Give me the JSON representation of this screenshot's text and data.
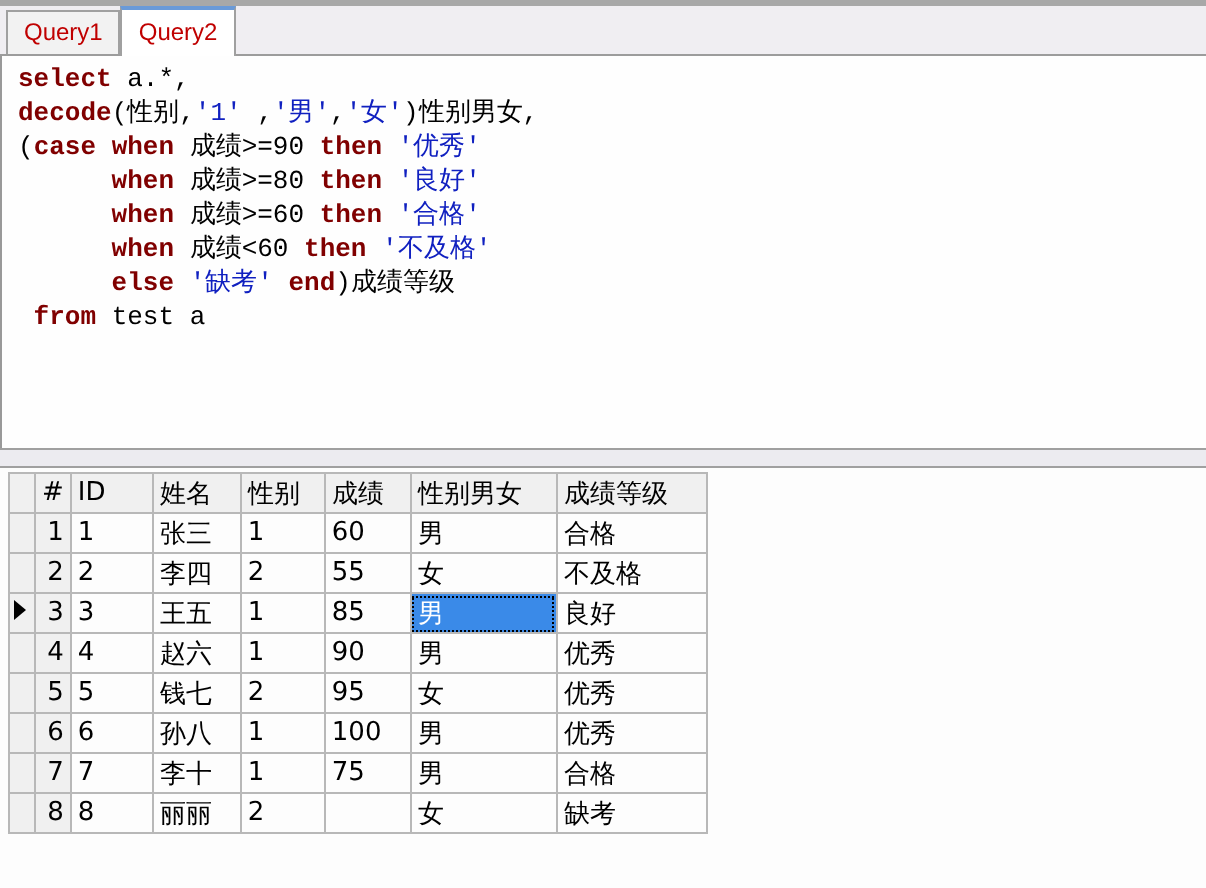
{
  "tabs": [
    {
      "label": "Query1",
      "selected": false
    },
    {
      "label": "Query2",
      "selected": true
    }
  ],
  "editor": {
    "lines": [
      {
        "tokens": [
          {
            "kind": "keyword",
            "text": "select"
          },
          {
            "kind": "plain",
            "text": " a.*,"
          }
        ]
      },
      {
        "tokens": [
          {
            "kind": "keyword",
            "text": "decode"
          },
          {
            "kind": "plain",
            "text": "(性别,"
          },
          {
            "kind": "string",
            "text": "'1'"
          },
          {
            "kind": "plain",
            "text": " ,"
          },
          {
            "kind": "string",
            "text": "'男'"
          },
          {
            "kind": "plain",
            "text": ","
          },
          {
            "kind": "string",
            "text": "'女'"
          },
          {
            "kind": "plain",
            "text": ")性别男女,"
          }
        ]
      },
      {
        "tokens": [
          {
            "kind": "plain",
            "text": "("
          },
          {
            "kind": "keyword",
            "text": "case when"
          },
          {
            "kind": "plain",
            "text": " 成绩>=90 "
          },
          {
            "kind": "keyword",
            "text": "then"
          },
          {
            "kind": "string",
            "text": " '优秀'"
          }
        ]
      },
      {
        "tokens": [
          {
            "kind": "keyword",
            "text": "      when"
          },
          {
            "kind": "plain",
            "text": " 成绩>=80 "
          },
          {
            "kind": "keyword",
            "text": "then"
          },
          {
            "kind": "string",
            "text": " '良好'"
          }
        ]
      },
      {
        "tokens": [
          {
            "kind": "keyword",
            "text": "      when"
          },
          {
            "kind": "plain",
            "text": " 成绩>=60 "
          },
          {
            "kind": "keyword",
            "text": "then"
          },
          {
            "kind": "string",
            "text": " '合格'"
          }
        ]
      },
      {
        "tokens": [
          {
            "kind": "keyword",
            "text": "      when"
          },
          {
            "kind": "plain",
            "text": " 成绩<60 "
          },
          {
            "kind": "keyword",
            "text": "then"
          },
          {
            "kind": "string",
            "text": " '不及格'"
          }
        ]
      },
      {
        "tokens": [
          {
            "kind": "keyword",
            "text": "      else"
          },
          {
            "kind": "string",
            "text": " '缺考' "
          },
          {
            "kind": "keyword",
            "text": "end"
          },
          {
            "kind": "plain",
            "text": ")成绩等级"
          }
        ]
      },
      {
        "tokens": [
          {
            "kind": "keyword",
            "text": " from"
          },
          {
            "kind": "plain",
            "text": " test a"
          }
        ]
      }
    ]
  },
  "grid": {
    "columns": [
      "#",
      "ID",
      "姓名",
      "性别",
      "成绩",
      "性别男女",
      "成绩等级"
    ],
    "rows": [
      {
        "current": false,
        "cells": [
          {
            "text": "1",
            "selected": false
          },
          {
            "text": "1",
            "selected": false
          },
          {
            "text": "张三",
            "selected": false
          },
          {
            "text": "1",
            "selected": false
          },
          {
            "text": "60",
            "selected": false
          },
          {
            "text": "男",
            "selected": false
          },
          {
            "text": "合格",
            "selected": false
          }
        ]
      },
      {
        "current": false,
        "cells": [
          {
            "text": "2",
            "selected": false
          },
          {
            "text": "2",
            "selected": false
          },
          {
            "text": "李四",
            "selected": false
          },
          {
            "text": "2",
            "selected": false
          },
          {
            "text": "55",
            "selected": false
          },
          {
            "text": "女",
            "selected": false
          },
          {
            "text": "不及格",
            "selected": false
          }
        ]
      },
      {
        "current": true,
        "cells": [
          {
            "text": "3",
            "selected": false
          },
          {
            "text": "3",
            "selected": false
          },
          {
            "text": "王五",
            "selected": false
          },
          {
            "text": "1",
            "selected": false
          },
          {
            "text": "85",
            "selected": false
          },
          {
            "text": "男",
            "selected": true
          },
          {
            "text": "良好",
            "selected": false
          }
        ]
      },
      {
        "current": false,
        "cells": [
          {
            "text": "4",
            "selected": false
          },
          {
            "text": "4",
            "selected": false
          },
          {
            "text": "赵六",
            "selected": false
          },
          {
            "text": "1",
            "selected": false
          },
          {
            "text": "90",
            "selected": false
          },
          {
            "text": "男",
            "selected": false
          },
          {
            "text": "优秀",
            "selected": false
          }
        ]
      },
      {
        "current": false,
        "cells": [
          {
            "text": "5",
            "selected": false
          },
          {
            "text": "5",
            "selected": false
          },
          {
            "text": "钱七",
            "selected": false
          },
          {
            "text": "2",
            "selected": false
          },
          {
            "text": "95",
            "selected": false
          },
          {
            "text": "女",
            "selected": false
          },
          {
            "text": "优秀",
            "selected": false
          }
        ]
      },
      {
        "current": false,
        "cells": [
          {
            "text": "6",
            "selected": false
          },
          {
            "text": "6",
            "selected": false
          },
          {
            "text": "孙八",
            "selected": false
          },
          {
            "text": "1",
            "selected": false
          },
          {
            "text": "100",
            "selected": false
          },
          {
            "text": "男",
            "selected": false
          },
          {
            "text": "优秀",
            "selected": false
          }
        ]
      },
      {
        "current": false,
        "cells": [
          {
            "text": "7",
            "selected": false
          },
          {
            "text": "7",
            "selected": false
          },
          {
            "text": "李十",
            "selected": false
          },
          {
            "text": "1",
            "selected": false
          },
          {
            "text": "75",
            "selected": false
          },
          {
            "text": "男",
            "selected": false
          },
          {
            "text": "合格",
            "selected": false
          }
        ]
      },
      {
        "current": false,
        "cells": [
          {
            "text": "8",
            "selected": false
          },
          {
            "text": "8",
            "selected": false
          },
          {
            "text": "丽丽",
            "selected": false
          },
          {
            "text": "2",
            "selected": false
          },
          null,
          {
            "text": "女",
            "selected": false
          },
          {
            "text": "缺考",
            "selected": false
          }
        ]
      }
    ]
  }
}
